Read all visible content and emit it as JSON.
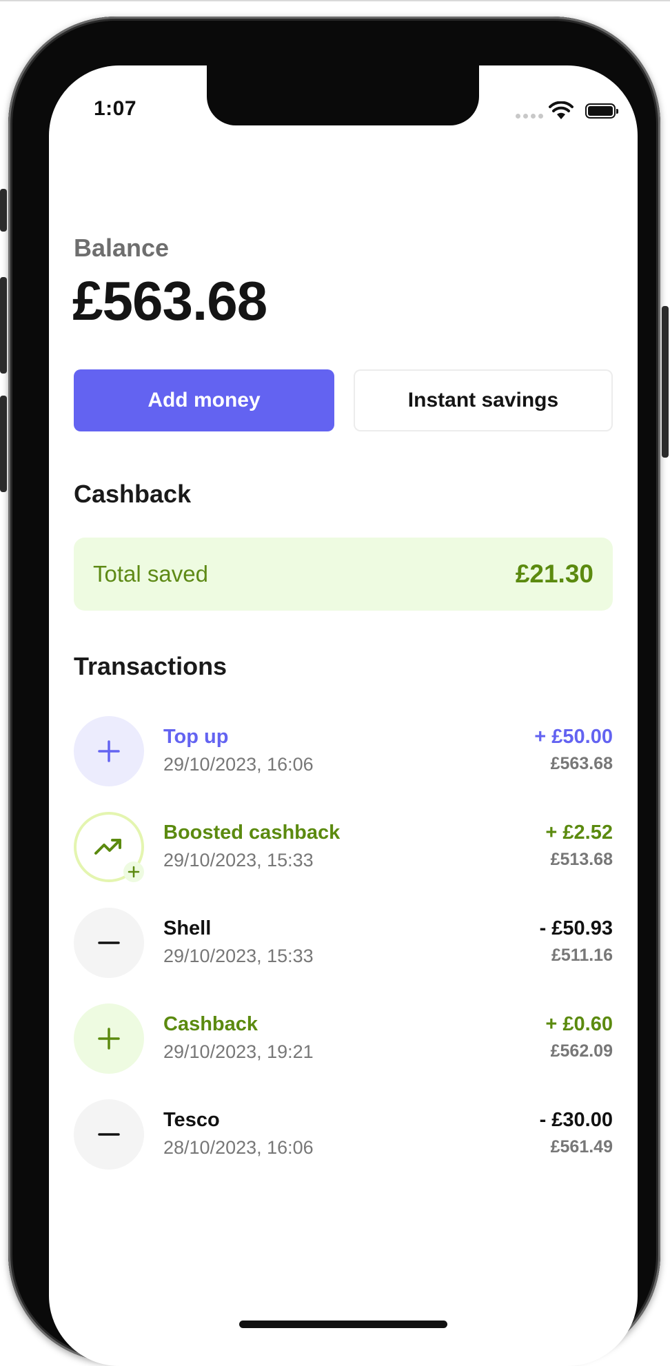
{
  "status_bar": {
    "time": "1:07"
  },
  "balance": {
    "label": "Balance",
    "amount": "£563.68"
  },
  "actions": {
    "add_money": "Add money",
    "instant_savings": "Instant savings"
  },
  "cashback": {
    "title": "Cashback",
    "total_label": "Total saved",
    "total_value": "£21.30"
  },
  "transactions": {
    "title": "Transactions",
    "items": [
      {
        "title": "Top up",
        "date": "29/10/2023, 16:06",
        "amount": "+ £50.00",
        "balance": "£563.68",
        "icon": "plus-icon"
      },
      {
        "title": "Boosted cashback",
        "date": "29/10/2023, 15:33",
        "amount": "+ £2.52",
        "balance": "£513.68",
        "icon": "trending-up-icon"
      },
      {
        "title": "Shell",
        "date": "29/10/2023, 15:33",
        "amount": "- £50.93",
        "balance": "£511.16",
        "icon": "minus-icon"
      },
      {
        "title": "Cashback",
        "date": "29/10/2023, 19:21",
        "amount": "+ £0.60",
        "balance": "£562.09",
        "icon": "plus-icon"
      },
      {
        "title": "Tesco",
        "date": "28/10/2023, 16:06",
        "amount": "- £30.00",
        "balance": "£561.49",
        "icon": "minus-icon"
      }
    ]
  },
  "colors": {
    "primary": "#6363f1",
    "cashback_green": "#5b8a0f",
    "cashback_bg": "#eefbe1",
    "debit_text": "#111111",
    "muted_text": "#777777"
  }
}
